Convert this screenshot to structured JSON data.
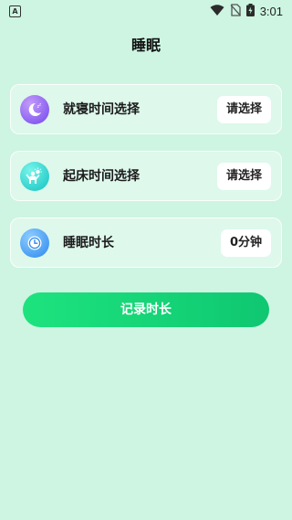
{
  "status_bar": {
    "app_badge": "A",
    "time": "3:01"
  },
  "page": {
    "title": "睡眠"
  },
  "rows": [
    {
      "label": "就寝时间选择",
      "value": "请选择",
      "icon": "moon-icon",
      "color_from": "#b48af5",
      "color_to": "#7c4df0"
    },
    {
      "label": "起床时间选择",
      "value": "请选择",
      "icon": "wake-up-icon",
      "color_from": "#5ff0e6",
      "color_to": "#19c9c5"
    },
    {
      "label": "睡眠时长",
      "value": "0分钟",
      "icon": "clock-icon",
      "color_from": "#7cc4ff",
      "color_to": "#2d8ef0"
    }
  ],
  "record_button": {
    "label": "记录时长",
    "color": "#13d478"
  }
}
